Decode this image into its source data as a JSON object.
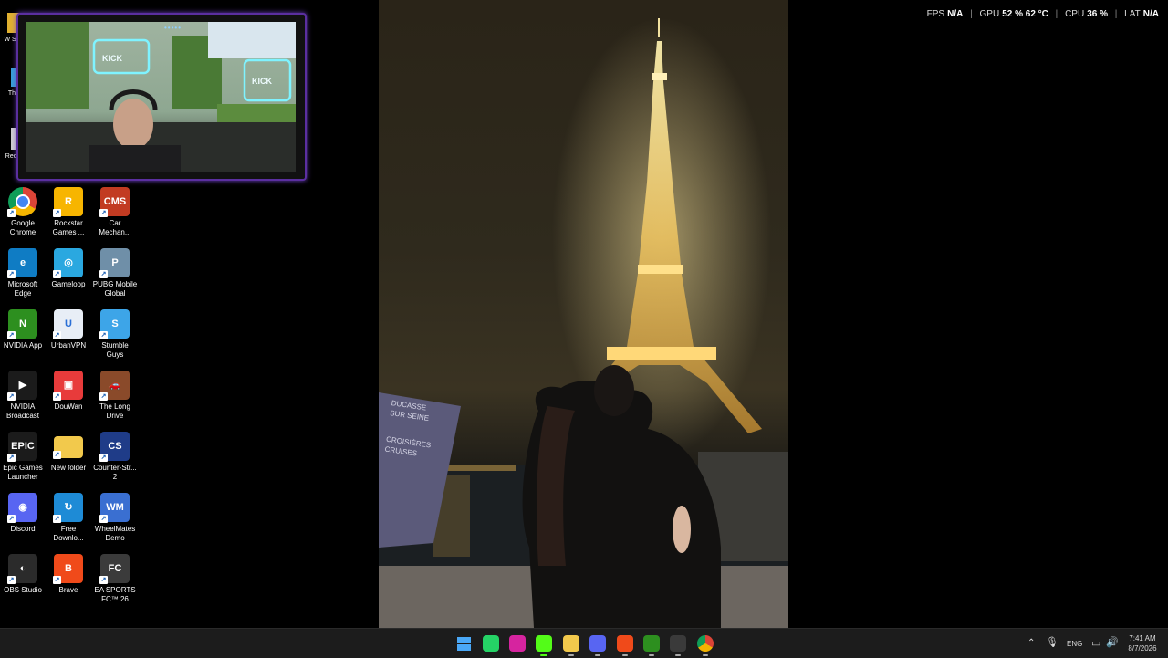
{
  "stats": {
    "fps_label": "FPS",
    "fps_value": "N/A",
    "gpu_label": "GPU",
    "gpu_value": "52 % 62 °C",
    "cpu_label": "CPU",
    "cpu_value": "36 %",
    "lat_label": "LAT",
    "lat_value": "N/A"
  },
  "desktop_icons": [
    {
      "label": "Google Chrome",
      "color": "#ffffff",
      "glyph": "",
      "icon": "chrome-icon"
    },
    {
      "label": "Rockstar Games ...",
      "color": "#f7b500",
      "glyph": "R",
      "icon": "rockstar-icon"
    },
    {
      "label": "Car Mechan...",
      "color": "#c23b22",
      "glyph": "CMS",
      "icon": "car-mechanic-icon"
    },
    {
      "label": "Microsoft Edge",
      "color": "#0f7cc4",
      "glyph": "e",
      "icon": "edge-icon"
    },
    {
      "label": "Gameloop",
      "color": "#2aa8e0",
      "glyph": "◎",
      "icon": "gameloop-icon"
    },
    {
      "label": "PUBG Mobile Global",
      "color": "#6f8fa8",
      "glyph": "P",
      "icon": "pubg-icon"
    },
    {
      "label": "NVIDIA App",
      "color": "#2d8f1f",
      "glyph": "N",
      "icon": "nvidia-app-icon"
    },
    {
      "label": "UrbanVPN",
      "color": "#e8eef6",
      "glyph": "U",
      "icon": "urbanvpn-icon"
    },
    {
      "label": "Stumble Guys",
      "color": "#3da5e8",
      "glyph": "S",
      "icon": "stumble-guys-icon"
    },
    {
      "label": "NVIDIA Broadcast",
      "color": "#1b1b1b",
      "glyph": "▶",
      "icon": "nvidia-broadcast-icon"
    },
    {
      "label": "DouWan",
      "color": "#e83b3b",
      "glyph": "▣",
      "icon": "douwan-icon"
    },
    {
      "label": "The Long Drive",
      "color": "#8a4a2a",
      "glyph": "🚗",
      "icon": "long-drive-icon"
    },
    {
      "label": "Epic Games Launcher",
      "color": "#1b1b1b",
      "glyph": "EPIC",
      "icon": "epic-games-icon"
    },
    {
      "label": "New folder",
      "color": "#f2c94c",
      "glyph": "",
      "icon": "folder-icon"
    },
    {
      "label": "Counter-Str... 2",
      "color": "#1f3c88",
      "glyph": "CS",
      "icon": "counter-strike-icon"
    },
    {
      "label": "Discord",
      "color": "#5865f2",
      "glyph": "◉",
      "icon": "discord-icon"
    },
    {
      "label": "Free Downlo...",
      "color": "#1e8bd6",
      "glyph": "↻",
      "icon": "free-download-icon"
    },
    {
      "label": "WheelMates Demo",
      "color": "#3a6fd1",
      "glyph": "WM",
      "icon": "wheelmates-icon"
    },
    {
      "label": "OBS Studio",
      "color": "#2b2b2b",
      "glyph": "◐",
      "icon": "obs-icon"
    },
    {
      "label": "Brave",
      "color": "#f04a1a",
      "glyph": "B",
      "icon": "brave-icon"
    },
    {
      "label": "EA SPORTS FC™ 26",
      "color": "#3b3b3b",
      "glyph": "FC",
      "icon": "ea-fc-icon"
    }
  ],
  "partial_icons": [
    {
      "label": "W Se",
      "icon": "partial-icon-1"
    },
    {
      "label": "Th",
      "icon": "partial-icon-2"
    },
    {
      "label": "Rec",
      "icon": "partial-icon-3"
    }
  ],
  "photo": {
    "banner_line1": "DUCASSE",
    "banner_line2": "SUR SEINE",
    "banner_line3": "CROISIÈRES",
    "banner_line4": "CRUISES"
  },
  "taskbar": {
    "apps": [
      {
        "icon": "windows-start-icon",
        "color": "#3a9af2"
      },
      {
        "icon": "whatsapp-icon",
        "color": "#25d366"
      },
      {
        "icon": "instagram-icon",
        "color": "#d6249f"
      },
      {
        "icon": "kick-icon",
        "color": "#53fc18"
      },
      {
        "icon": "file-explorer-icon",
        "color": "#f2c94c"
      },
      {
        "icon": "discord-taskbar-icon",
        "color": "#5865f2"
      },
      {
        "icon": "brave-taskbar-icon",
        "color": "#f04a1a"
      },
      {
        "icon": "nvidia-taskbar-icon",
        "color": "#2d8f1f"
      },
      {
        "icon": "obs-taskbar-icon",
        "color": "#3a3a3a"
      },
      {
        "icon": "chrome-taskbar-icon",
        "color": "#ffffff"
      }
    ],
    "language": "ENG",
    "time": "7:41 AM",
    "date": "8/7/2026"
  }
}
